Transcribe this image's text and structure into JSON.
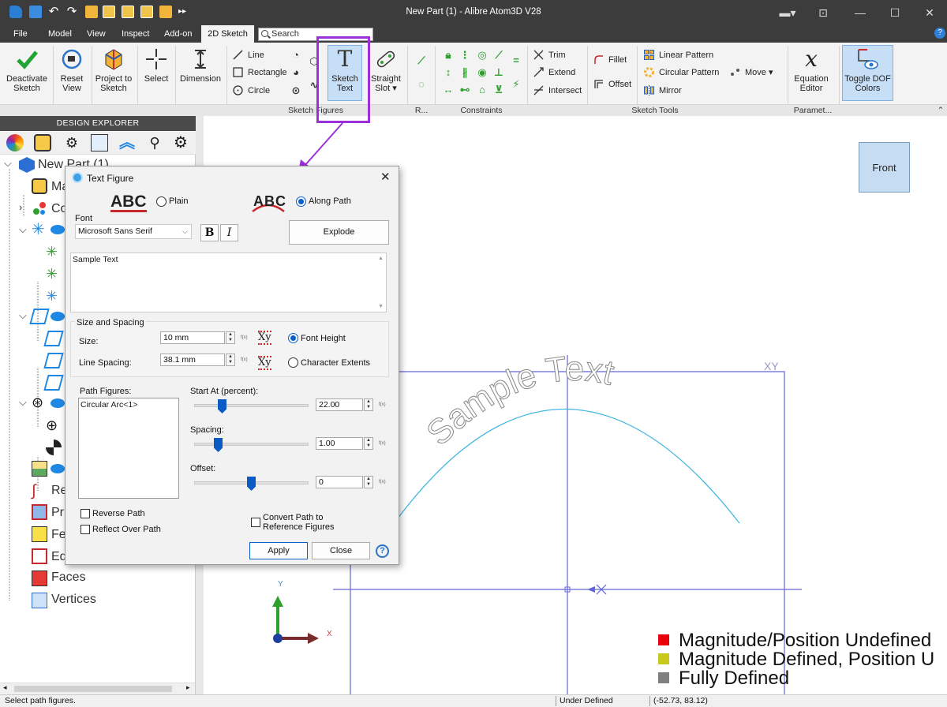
{
  "window": {
    "title": "New Part (1) - Alibre Atom3D V28"
  },
  "menu": {
    "file": "File",
    "model": "Model",
    "view": "View",
    "inspect": "Inspect",
    "addon": "Add-on",
    "sketch2d": "2D Sketch"
  },
  "search": {
    "placeholder": "Search"
  },
  "ribbon": {
    "deactivate": "Deactivate Sketch",
    "reset_view": "Reset View",
    "project": "Project to Sketch",
    "select": "Select",
    "dimension": "Dimension",
    "line": "Line",
    "rectangle": "Rectangle",
    "circle": "Circle",
    "sketch_text": "Sketch Text",
    "straight_slot": "Straight Slot",
    "trim": "Trim",
    "extend": "Extend",
    "intersect": "Intersect",
    "fillet": "Fillet",
    "offset": "Offset",
    "linear_pattern": "Linear Pattern",
    "circular_pattern": "Circular Pattern",
    "mirror": "Mirror",
    "move": "Move",
    "equation_editor": "Equation Editor",
    "toggle_dof": "Toggle DOF Colors",
    "groups": {
      "sketch_figures": "Sketch Figures",
      "r": "R...",
      "constraints": "Constraints",
      "sketch_tools": "Sketch Tools",
      "param": "Paramet..."
    }
  },
  "explorer": {
    "header": "DESIGN EXPLORER",
    "items": {
      "root": "New Part (1)",
      "ma": "Ma",
      "co": "Co",
      "re": "Re",
      "pr": "Pr",
      "fe": "Fe",
      "ed": "Ed",
      "faces": "Faces",
      "vertices": "Vertices"
    }
  },
  "canvas": {
    "front": "Front",
    "axis_y": "Y",
    "axis_x": "X",
    "xy": "XY",
    "sample": "Sample Text"
  },
  "legend": {
    "undefined": "Magnitude/Position Undefined",
    "mag_defined": "Magnitude Defined, Position U",
    "fully": "Fully Defined"
  },
  "colors": {
    "undefined": "#e8000b",
    "mag_defined": "#c8c81e",
    "fully": "#808080",
    "accent": "#9b30d9",
    "sketch_blue": "#6464d8",
    "arc": "#45b8e0"
  },
  "status": {
    "message": "Select path figures.",
    "state": "Under Defined",
    "coords": "(-52.73, 83.12)"
  },
  "dialog": {
    "title": "Text Figure",
    "plain_sample": "ABC",
    "plain": "Plain",
    "path_sample": "ABC",
    "along_path": "Along Path",
    "font_label": "Font",
    "font_value": "Microsoft Sans Serif",
    "bold": "B",
    "italic": "I",
    "explode": "Explode",
    "text": "Sample Text",
    "size_spacing": "Size and Spacing",
    "size_label": "Size:",
    "size_value": "10 mm",
    "line_spacing_label": "Line Spacing:",
    "line_spacing_value": "38.1 mm",
    "xy": "Xy",
    "font_height": "Font Height",
    "char_extents": "Character Extents",
    "path_figures": "Path Figures:",
    "path_item": "Circular Arc<1>",
    "start_at": "Start At (percent):",
    "start_value": "22.00",
    "spacing": "Spacing:",
    "spacing_value": "1.00",
    "offset": "Offset:",
    "offset_value": "0",
    "reverse_path": "Reverse Path",
    "reflect": "Reflect Over Path",
    "convert_1": "Convert Path to",
    "convert_2": "Reference Figures",
    "apply": "Apply",
    "close": "Close",
    "help": "?"
  }
}
